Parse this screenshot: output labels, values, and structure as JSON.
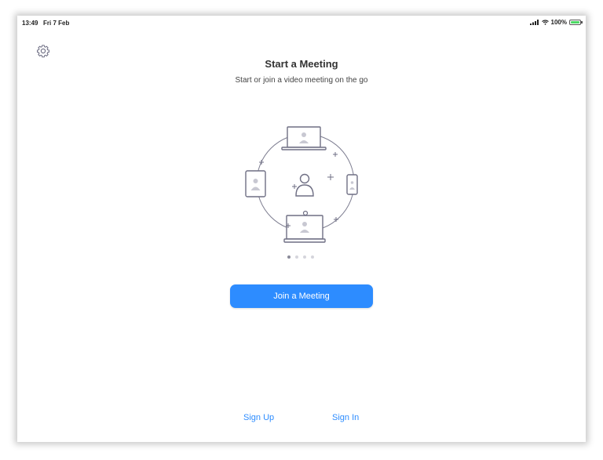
{
  "status_bar": {
    "time": "13:49",
    "date": "Fri 7 Feb",
    "battery": "100%"
  },
  "icons": {
    "settings": "gear-icon",
    "signal": "signal-icon",
    "wifi": "wifi-icon",
    "battery": "battery-icon"
  },
  "header": {
    "title": "Start a Meeting",
    "subtitle": "Start or join a video meeting on the go"
  },
  "carousel": {
    "page_count": 4,
    "active_index": 0
  },
  "actions": {
    "join_label": "Join a Meeting",
    "sign_up_label": "Sign Up",
    "sign_in_label": "Sign In"
  },
  "colors": {
    "accent": "#2d8cff",
    "illustration_stroke": "#6f6f84",
    "battery_fill": "#4cd964"
  }
}
